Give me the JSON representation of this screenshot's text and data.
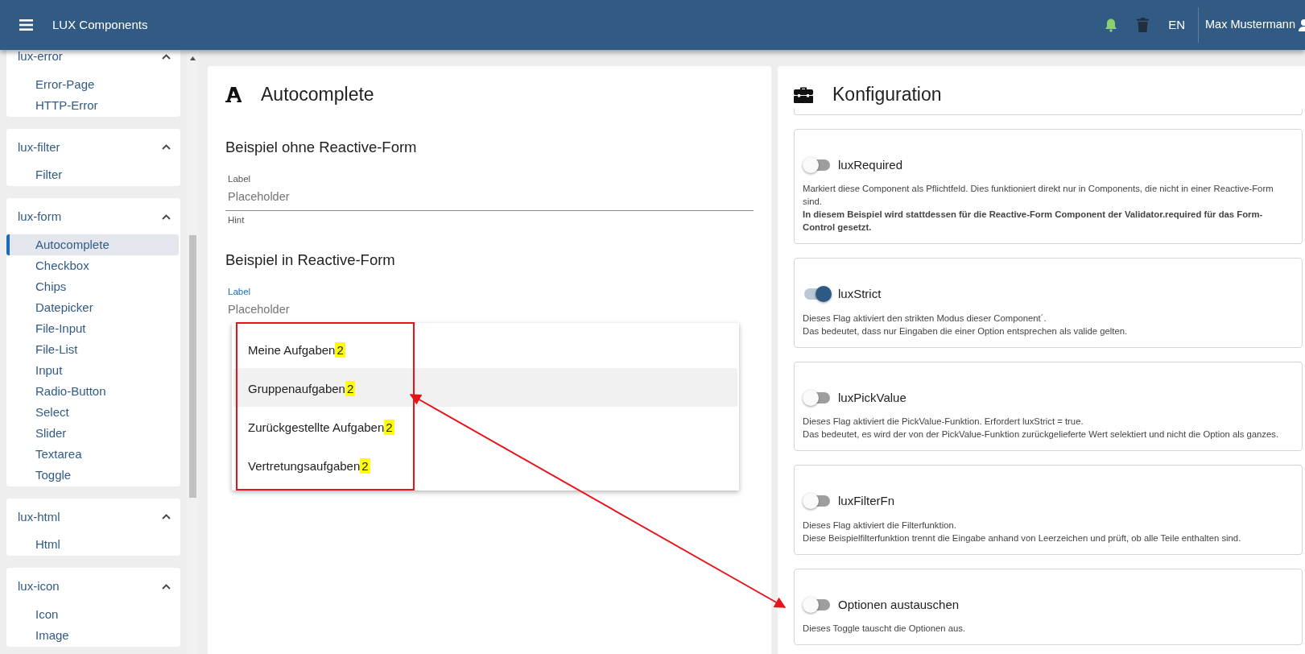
{
  "header": {
    "title": "LUX Components",
    "language": "EN",
    "user": "Max Mustermann"
  },
  "sidebar": {
    "groups": [
      {
        "title": "lux-error",
        "expanded": true,
        "items": [
          {
            "label": "Error-Page",
            "selected": false
          },
          {
            "label": "HTTP-Error",
            "selected": false
          }
        ]
      },
      {
        "title": "lux-filter",
        "expanded": true,
        "items": [
          {
            "label": "Filter",
            "selected": false
          }
        ]
      },
      {
        "title": "lux-form",
        "expanded": true,
        "items": [
          {
            "label": "Autocomplete",
            "selected": true
          },
          {
            "label": "Checkbox",
            "selected": false
          },
          {
            "label": "Chips",
            "selected": false
          },
          {
            "label": "Datepicker",
            "selected": false
          },
          {
            "label": "File-Input",
            "selected": false
          },
          {
            "label": "File-List",
            "selected": false
          },
          {
            "label": "Input",
            "selected": false
          },
          {
            "label": "Radio-Button",
            "selected": false
          },
          {
            "label": "Select",
            "selected": false
          },
          {
            "label": "Slider",
            "selected": false
          },
          {
            "label": "Textarea",
            "selected": false
          },
          {
            "label": "Toggle",
            "selected": false
          }
        ]
      },
      {
        "title": "lux-html",
        "expanded": true,
        "items": [
          {
            "label": "Html",
            "selected": false
          }
        ]
      },
      {
        "title": "lux-icon",
        "expanded": true,
        "items": [
          {
            "label": "Icon",
            "selected": false
          },
          {
            "label": "Image",
            "selected": false
          }
        ]
      }
    ]
  },
  "example": {
    "title": "Autocomplete",
    "sections": [
      {
        "heading": "Beispiel ohne Reactive-Form",
        "label": "Label",
        "focused": false,
        "placeholder": "Placeholder",
        "hint": "Hint"
      },
      {
        "heading": "Beispiel in Reactive-Form",
        "label": "Label",
        "focused": true,
        "placeholder": "Placeholder",
        "options": [
          {
            "label": "Meine Aufgaben",
            "badge": "2",
            "hovered": false
          },
          {
            "label": "Gruppenaufgaben",
            "badge": "2",
            "hovered": true
          },
          {
            "label": "Zurückgestellte Aufgaben",
            "badge": "2",
            "hovered": false
          },
          {
            "label": "Vertretungsaufgaben",
            "badge": "2",
            "hovered": false
          }
        ]
      }
    ]
  },
  "configuration": {
    "title": "Konfiguration",
    "options": [
      {
        "name": "luxRequired",
        "on": false,
        "lines": [
          {
            "text": "Markiert diese Component als Pflichtfeld. Dies funktioniert direkt nur in Components, die nicht in einer Reactive-Form sind.",
            "bold": false
          },
          {
            "text": "In diesem Beispiel wird stattdessen für die Reactive-Form Component der Validator.required für das Form-Control gesetzt.",
            "bold": true
          }
        ]
      },
      {
        "name": "luxStrict",
        "on": true,
        "lines": [
          {
            "text": "Dieses Flag aktiviert den strikten Modus dieser Component´.",
            "bold": false
          },
          {
            "text": "Das bedeutet, dass nur Eingaben die einer Option entsprechen als valide gelten.",
            "bold": false
          }
        ]
      },
      {
        "name": "luxPickValue",
        "on": false,
        "lines": [
          {
            "text": "Dieses Flag aktiviert die PickValue-Funktion. Erfordert luxStrict = true.",
            "bold": false
          },
          {
            "text": "Das bedeutet, es wird der von der PickValue-Funktion zurückgelieferte Wert selektiert und nicht die Option als ganzes.",
            "bold": false
          }
        ]
      },
      {
        "name": "luxFilterFn",
        "on": false,
        "lines": [
          {
            "text": "Dieses Flag aktiviert die Filterfunktion.",
            "bold": false
          },
          {
            "text": "Diese Beispielfilterfunktion trennt die Eingabe anhand von Leerzeichen und prüft, ob alle Teile enthalten sind.",
            "bold": false
          }
        ]
      },
      {
        "name": "Optionen austauschen",
        "on": false,
        "lines": [
          {
            "text": "Dieses Toggle tauscht die Optionen aus.",
            "bold": false
          }
        ]
      }
    ]
  }
}
